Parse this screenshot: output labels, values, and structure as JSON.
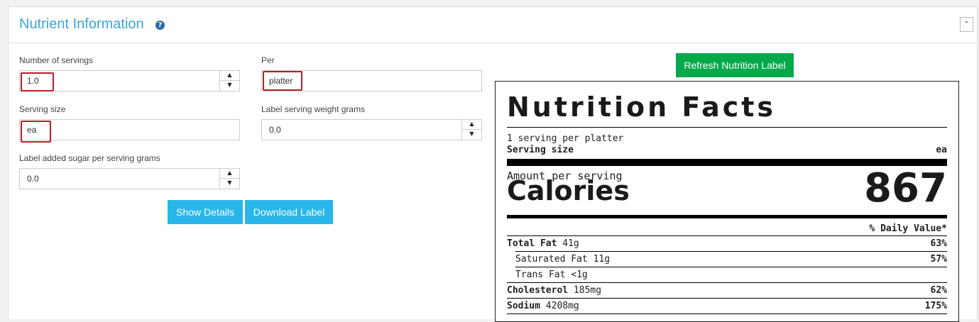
{
  "panel": {
    "title": "Nutrient Information",
    "help_icon": "?",
    "collapse_icon": "chevron-double-up-icon",
    "collapse_glyph": "⌃"
  },
  "form": {
    "servings_label": "Number of servings",
    "servings_value": "1.0",
    "per_label": "Per",
    "per_value": "platter",
    "serving_size_label": "Serving size",
    "serving_size_value": "ea",
    "weight_label": "Label serving weight grams",
    "weight_value": "0.0",
    "sugar_label": "Label added sugar per serving grams",
    "sugar_value": "0.0",
    "spinner_up": "▲",
    "spinner_down": "▼"
  },
  "buttons": {
    "show_details": "Show Details",
    "download_label": "Download Label",
    "refresh": "Refresh Nutrition Label"
  },
  "colors": {
    "accent_blue": "#29b6e9",
    "title_blue": "#3aa7dd",
    "green": "#05a94a",
    "highlight_red": "#b52024"
  },
  "nutrition": {
    "title": "Nutrition Facts",
    "servings_per": "1 serving per platter",
    "serving_size_label": "Serving size",
    "serving_size_value": "ea",
    "amount_per_serving": "Amount per serving",
    "calories_label": "Calories",
    "calories_value": "867",
    "daily_value_header": "% Daily Value*",
    "rows": [
      {
        "label": "Total Fat",
        "amount": "41g",
        "dv": "63%",
        "bold": true
      },
      {
        "label": "Saturated Fat",
        "amount": "11g",
        "dv": "57%",
        "bold": false
      },
      {
        "label": "Trans Fat",
        "amount": "<1g",
        "dv": "",
        "bold": false
      },
      {
        "label": "Cholesterol",
        "amount": "185mg",
        "dv": "62%",
        "bold": true
      },
      {
        "label": "Sodium",
        "amount": "4208mg",
        "dv": "175%",
        "bold": true
      }
    ]
  }
}
